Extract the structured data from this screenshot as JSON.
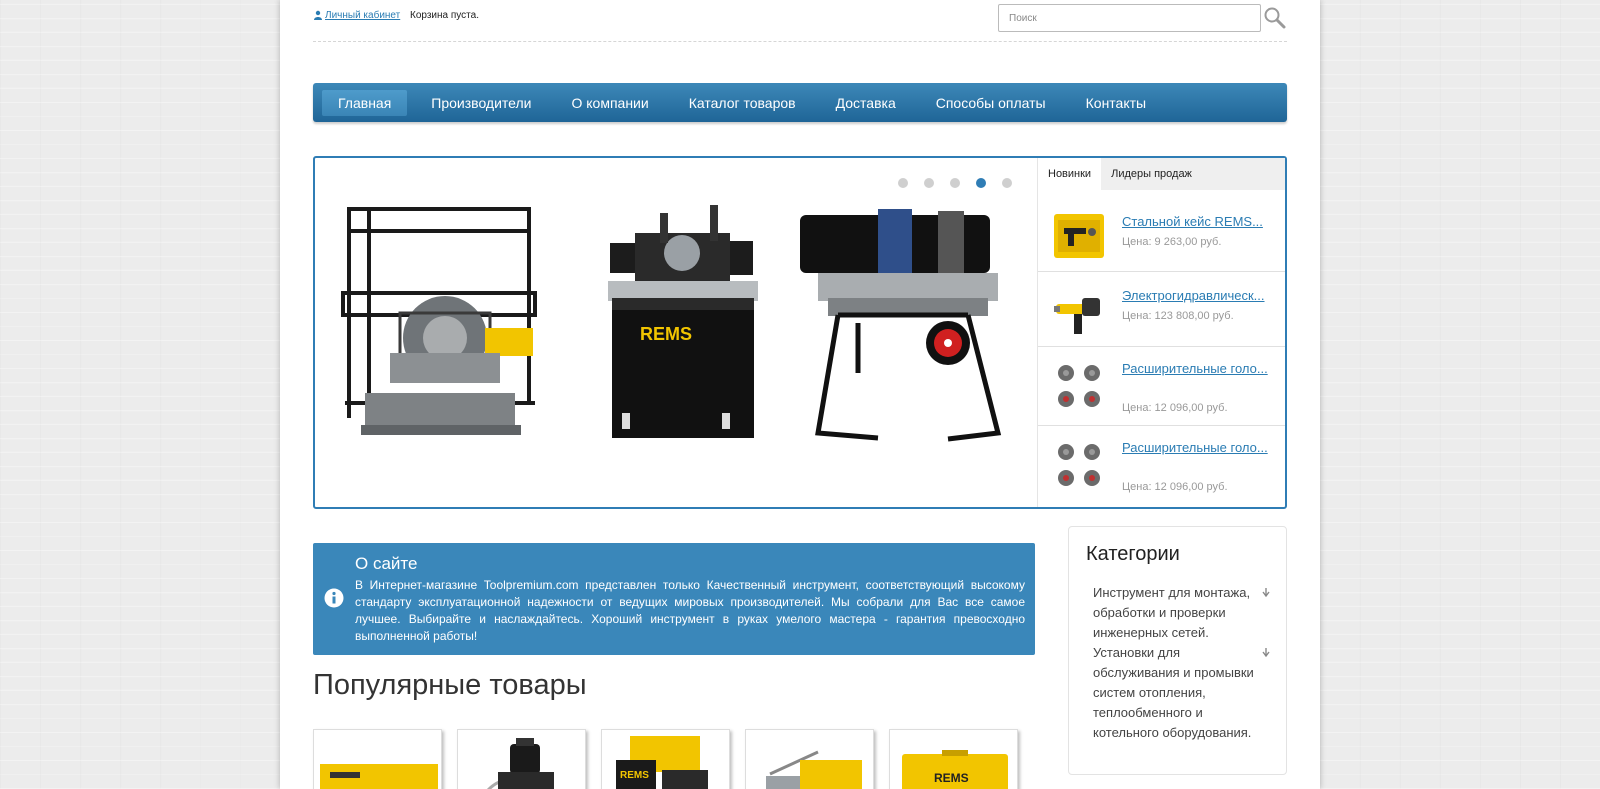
{
  "header": {
    "account_link": "Личный кабинет",
    "cart_status": "Корзина пуста.",
    "search_placeholder": "Поиск"
  },
  "nav": {
    "items": [
      "Главная",
      "Производители",
      "О компании",
      "Каталог товаров",
      "Доставка",
      "Способы оплаты",
      "Контакты"
    ],
    "active_index": 0
  },
  "slider": {
    "dot_count": 5,
    "active_dot": 4,
    "images": [
      "rems-frame-welding-machine",
      "rems-box-welding-machine",
      "rems-stand-welding-machine"
    ],
    "brand_label": "REMS"
  },
  "product_tabs": {
    "tabs": [
      "Новинки",
      "Лидеры продаж"
    ],
    "active_tab": 0,
    "products": [
      {
        "title": "Стальной кейс REMS...",
        "price": "Цена: 9 263,00 руб."
      },
      {
        "title": "Электрогидравлическ...",
        "price": "Цена: 123 808,00 руб."
      },
      {
        "title": "Расширительные голо...",
        "price": "Цена: 12 096,00 руб."
      },
      {
        "title": "Расширительные голо...",
        "price": "Цена: 12 096,00 руб."
      }
    ]
  },
  "about": {
    "title": "О сайте",
    "text": "В Интернет-магазине Toolpremium.com представлен только Качественный инструмент, соответствующий высокому стандарту эксплуатационной надежности от ведущих мировых производителей. Мы собрали для Вас все самое лучшее. Выбирайте и наслаждайтесь. Хороший инструмент в руках умелого мастера - гарантия превосходно выполненной работы!"
  },
  "popular": {
    "title": "Популярные товары",
    "card_count": 5
  },
  "categories": {
    "title": "Категории",
    "items": [
      "Инструмент для монтажа, обработки и проверки инженерных сетей.",
      "Установки для обслуживания и промывки систем отопления, теплообменного и котельного оборудования."
    ]
  },
  "colors": {
    "accent": "#2f7db5",
    "nav_top": "#3d88b8",
    "nav_bottom": "#1f6597",
    "about_bg": "#3a87ba",
    "link": "#2a7cb3",
    "rems_yellow": "#f2c500"
  }
}
